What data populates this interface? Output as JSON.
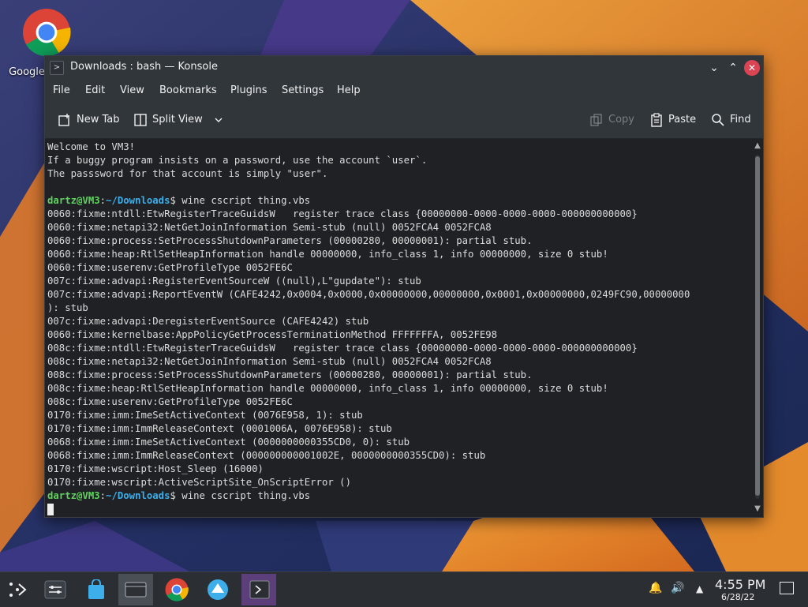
{
  "desktop": {
    "icon_label": "Google"
  },
  "window": {
    "title": "Downloads : bash — Konsole",
    "minimize_glyph": "⌄",
    "maximize_glyph": "⌃",
    "close_glyph": "✕"
  },
  "menu": {
    "items": [
      "File",
      "Edit",
      "View",
      "Bookmarks",
      "Plugins",
      "Settings",
      "Help"
    ]
  },
  "toolbar": {
    "new_tab": "New Tab",
    "split_view": "Split View",
    "copy": "Copy",
    "paste": "Paste",
    "find": "Find"
  },
  "terminal": {
    "welcome": [
      "Welcome to VM3!",
      "If a buggy program insists on a password, use the account `user`.",
      "The passsword for that account is simply \"user\"."
    ],
    "prompt_user": "dartz@VM3",
    "prompt_sep": ":",
    "prompt_path": "~/Downloads",
    "prompt_symbol": "$ ",
    "command": "wine cscript thing.vbs",
    "output": [
      "0060:fixme:ntdll:EtwRegisterTraceGuidsW   register trace class {00000000-0000-0000-0000-000000000000}",
      "0060:fixme:netapi32:NetGetJoinInformation Semi-stub (null) 0052FCA4 0052FCA8",
      "0060:fixme:process:SetProcessShutdownParameters (00000280, 00000001): partial stub.",
      "0060:fixme:heap:RtlSetHeapInformation handle 00000000, info_class 1, info 00000000, size 0 stub!",
      "0060:fixme:userenv:GetProfileType 0052FE6C",
      "007c:fixme:advapi:RegisterEventSourceW ((null),L\"gupdate\"): stub",
      "007c:fixme:advapi:ReportEventW (CAFE4242,0x0004,0x0000,0x00000000,00000000,0x0001,0x00000000,0249FC90,00000000",
      "): stub",
      "007c:fixme:advapi:DeregisterEventSource (CAFE4242) stub",
      "0060:fixme:kernelbase:AppPolicyGetProcessTerminationMethod FFFFFFFA, 0052FE98",
      "008c:fixme:ntdll:EtwRegisterTraceGuidsW   register trace class {00000000-0000-0000-0000-000000000000}",
      "008c:fixme:netapi32:NetGetJoinInformation Semi-stub (null) 0052FCA4 0052FCA8",
      "008c:fixme:process:SetProcessShutdownParameters (00000280, 00000001): partial stub.",
      "008c:fixme:heap:RtlSetHeapInformation handle 00000000, info_class 1, info 00000000, size 0 stub!",
      "008c:fixme:userenv:GetProfileType 0052FE6C",
      "0170:fixme:imm:ImeSetActiveContext (0076E958, 1): stub",
      "0170:fixme:imm:ImmReleaseContext (0001006A, 0076E958): stub",
      "0068:fixme:imm:ImeSetActiveContext (0000000000355CD0, 0): stub",
      "0068:fixme:imm:ImmReleaseContext (000000000001002E, 0000000000355CD0): stub",
      "0170:fixme:wscript:Host_Sleep (16000)",
      "0170:fixme:wscript:ActiveScriptSite_OnScriptError ()"
    ]
  },
  "taskbar": {
    "time": "4:55 PM",
    "date": "6/28/22"
  },
  "colors": {
    "titlebar": "#31363b",
    "terminal_bg": "#1f2124",
    "prompt_user": "#5fd35f",
    "prompt_path": "#3daee9",
    "close_button": "#da4453"
  }
}
